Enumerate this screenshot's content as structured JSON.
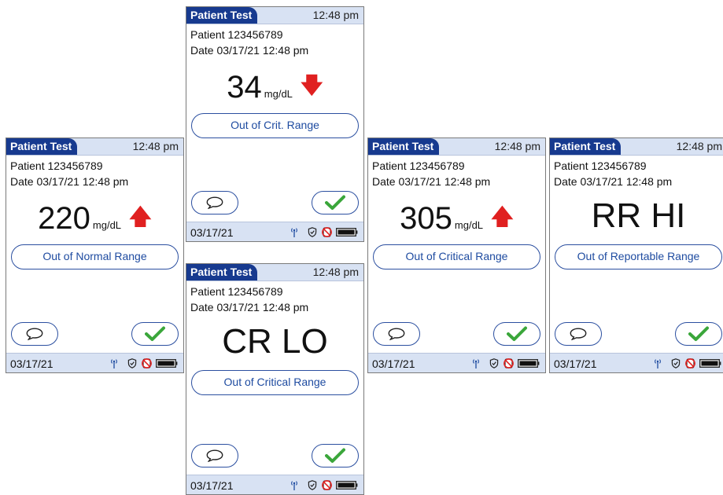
{
  "screens": [
    {
      "title": "Patient Test",
      "time": "12:48 pm",
      "patient": "Patient 123456789",
      "date_line": "Date 03/17/21 12:48 pm",
      "value": "220",
      "unit": "mg/dL",
      "arrow": "up",
      "range_label": "Out of Normal Range",
      "status_date": "03/17/21"
    },
    {
      "title": "Patient Test",
      "time": "12:48 pm",
      "patient": "Patient 123456789",
      "date_line": "Date 03/17/21 12:48 pm",
      "value": "34",
      "unit": "mg/dL",
      "arrow": "down",
      "range_label": "Out of Crit. Range",
      "status_date": "03/17/21"
    },
    {
      "title": "Patient Test",
      "time": "12:48 pm",
      "patient": "Patient 123456789",
      "date_line": "Date 03/17/21 12:48 pm",
      "code": "CR LO",
      "range_label": "Out of Critical Range",
      "status_date": "03/17/21"
    },
    {
      "title": "Patient Test",
      "time": "12:48 pm",
      "patient": "Patient 123456789",
      "date_line": "Date 03/17/21 12:48 pm",
      "value": "305",
      "unit": "mg/dL",
      "arrow": "up",
      "range_label": "Out of Critical Range",
      "status_date": "03/17/21"
    },
    {
      "title": "Patient Test",
      "time": "12:48 pm",
      "patient": "Patient 123456789",
      "date_line": "Date 03/17/21 12:48 pm",
      "code": "RR HI",
      "range_label": "Out of Reportable Range",
      "status_date": "03/17/21"
    }
  ],
  "icons": {
    "comment": "speech-bubble-icon",
    "accept": "checkmark-icon",
    "arrow_up": "red-up-arrow",
    "arrow_down": "red-down-arrow",
    "wireless": "antenna-icon",
    "security": "shield-check-icon",
    "no_battery": "crossed-out-battery-icon",
    "battery": "battery-full-icon"
  },
  "colors": {
    "header_tab": "#173a8f",
    "header_bar": "#d8e2f3",
    "button_border": "#2b4fa0",
    "arrow": "#e02020",
    "check": "#3aa63a"
  }
}
